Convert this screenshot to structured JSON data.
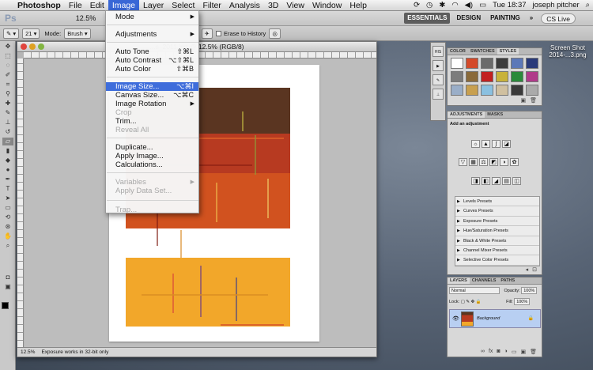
{
  "menubar": {
    "apple": "",
    "app_name": "Photoshop",
    "items": [
      "File",
      "Edit",
      "Image",
      "Layer",
      "Select",
      "Filter",
      "Analysis",
      "3D",
      "View",
      "Window",
      "Help"
    ],
    "active_item": "Image",
    "clock": "Tue 18:37",
    "user": "joseph pitcher"
  },
  "appbar": {
    "logo": "Ps",
    "zoom": "12.5%",
    "workspaces": [
      "ESSENTIALS",
      "DESIGN",
      "PAINTING"
    ],
    "more": "»",
    "cs_live": "CS Live"
  },
  "options": {
    "brush_size": "21",
    "mode_label": "Mode:",
    "mode_value": "Brush",
    "erase_history": "Erase to History"
  },
  "document": {
    "title": "...s_2011.jpg @ 12.5% (RGB/8)",
    "zoom": "12.5%",
    "status": "Exposure works in 32-bit only"
  },
  "image_menu": {
    "items": [
      {
        "label": "Mode",
        "shortcut": "",
        "submenu": true,
        "disabled": false
      },
      {
        "label": "Adjustments",
        "shortcut": "",
        "submenu": true,
        "disabled": false
      },
      {
        "label": "Auto Tone",
        "shortcut": "⇧⌘L",
        "submenu": false,
        "disabled": false
      },
      {
        "label": "Auto Contrast",
        "shortcut": "⌥⇧⌘L",
        "submenu": false,
        "disabled": false
      },
      {
        "label": "Auto Color",
        "shortcut": "⇧⌘B",
        "submenu": false,
        "disabled": false
      },
      {
        "label": "Image Size...",
        "shortcut": "⌥⌘I",
        "submenu": false,
        "disabled": false,
        "highlighted": true
      },
      {
        "label": "Canvas Size...",
        "shortcut": "⌥⌘C",
        "submenu": false,
        "disabled": false
      },
      {
        "label": "Image Rotation",
        "shortcut": "",
        "submenu": true,
        "disabled": false
      },
      {
        "label": "Crop",
        "shortcut": "",
        "submenu": false,
        "disabled": true
      },
      {
        "label": "Trim...",
        "shortcut": "",
        "submenu": false,
        "disabled": false
      },
      {
        "label": "Reveal All",
        "shortcut": "",
        "submenu": false,
        "disabled": true
      },
      {
        "label": "Duplicate...",
        "shortcut": "",
        "submenu": false,
        "disabled": false
      },
      {
        "label": "Apply Image...",
        "shortcut": "",
        "submenu": false,
        "disabled": false
      },
      {
        "label": "Calculations...",
        "shortcut": "",
        "submenu": false,
        "disabled": false
      },
      {
        "label": "Variables",
        "shortcut": "",
        "submenu": true,
        "disabled": true
      },
      {
        "label": "Apply Data Set...",
        "shortcut": "",
        "submenu": false,
        "disabled": true
      },
      {
        "label": "Trap...",
        "shortcut": "",
        "submenu": false,
        "disabled": true
      }
    ]
  },
  "swatch_panel": {
    "tabs": [
      "COLOR",
      "SWATCHES",
      "STYLES"
    ],
    "active_tab": "STYLES",
    "style_colors": [
      "#ffffff",
      "#d44a2a",
      "#6b6b6b",
      "#3c3c3c",
      "#5c78b8",
      "#2a3a7a",
      "#7c7c7c",
      "#8a6a3a",
      "#c22020",
      "#c8b23a",
      "#2a8a3a",
      "#b03a8a",
      "#9aaec8",
      "#c8a050",
      "#8ac0e0",
      "#d0c0a0",
      "#3a3a3a",
      "#aaaaaa"
    ]
  },
  "adjustments_panel": {
    "tabs": [
      "ADJUSTMENTS",
      "MASKS"
    ],
    "heading": "Add an adjustment",
    "presets": [
      "Levels Presets",
      "Curves Presets",
      "Exposure Presets",
      "Hue/Saturation Presets",
      "Black & White Presets",
      "Channel Mixer Presets",
      "Selective Color Presets"
    ]
  },
  "layers_panel": {
    "tabs": [
      "LAYERS",
      "CHANNELS",
      "PATHS"
    ],
    "blend_mode": "Normal",
    "opacity_label": "Opacity:",
    "opacity": "100%",
    "lock_label": "Lock:",
    "fill_label": "Fill:",
    "fill": "100%",
    "layer_name": "Background"
  },
  "desktop": {
    "file_label_line1": "Screen Shot",
    "file_label_line2": "2014-...3.png"
  },
  "colors": {
    "menu_highlight": "#3e6ddb",
    "quilt_brown": "#5a3521",
    "quilt_red": "#b73a21",
    "quilt_orange": "#e8661f",
    "quilt_yellow": "#f2a72a"
  }
}
